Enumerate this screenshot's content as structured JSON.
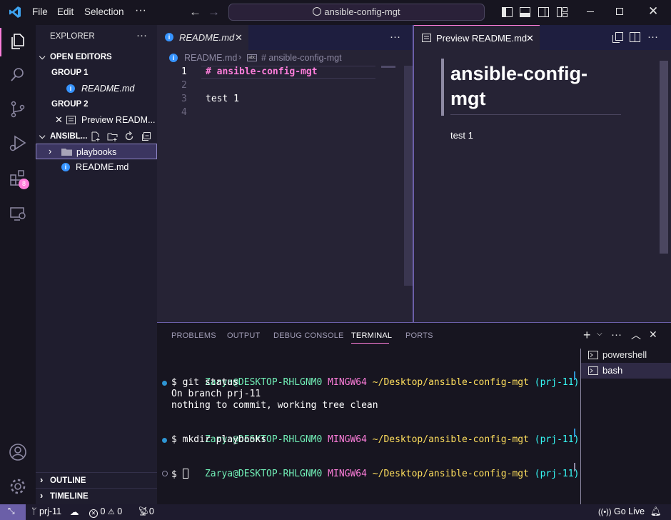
{
  "titlebar": {
    "menu": [
      "File",
      "Edit",
      "Selection"
    ],
    "more": "···",
    "search_text": "ansible-config-mgt"
  },
  "activity": {
    "badge_count": "8"
  },
  "sidebar": {
    "title": "EXPLORER",
    "more": "···",
    "open_editors": "OPEN EDITORS",
    "group1": "GROUP 1",
    "group1_file": "README.md",
    "group2": "GROUP 2",
    "group2_file": "Preview READM...",
    "project": "ANSIBL...",
    "folder": "playbooks",
    "file": "README.md",
    "outline": "OUTLINE",
    "timeline": "TIMELINE"
  },
  "editor": {
    "tab_label": "README.md",
    "breadcrumb_file": "README.md",
    "breadcrumb_symbol": "# ansible-config-mgt",
    "line_numbers": [
      "1",
      "2",
      "3",
      "4"
    ],
    "lines": [
      "# ansible-config-mgt",
      "",
      "test 1",
      ""
    ],
    "more": "···"
  },
  "preview": {
    "tab_label": "Preview README.md",
    "heading_line1": "ansible-config-",
    "heading_line2": "mgt",
    "paragraph": "test 1",
    "more": "···"
  },
  "panel": {
    "tabs": [
      "PROBLEMS",
      "OUTPUT",
      "DEBUG CONSOLE",
      "TERMINAL",
      "PORTS"
    ],
    "active_tab": "TERMINAL",
    "more": "···",
    "terminals": [
      "powershell",
      "bash"
    ],
    "prompt_user": "Zarya@DESKTOP-RHLGNM0",
    "prompt_env": "MINGW64",
    "prompt_path": "~/Desktop/ansible-config-mgt",
    "prompt_branch": "(prj-11)",
    "cmd1": "$ git status",
    "out1": "On branch prj-11",
    "out2": "nothing to commit, working tree clean",
    "cmd2": "$ mkdir playbooks",
    "cmd3": "$ "
  },
  "status": {
    "branch": "prj-11",
    "errors": "0",
    "warnings": "0",
    "ports": "0",
    "golive": "Go Live"
  },
  "colors": {
    "accent": "#ff7edb",
    "heading": "#fede5d",
    "bg": "#262335",
    "terminal_green": "#72f1b8",
    "terminal_pink": "#ff7edb"
  }
}
